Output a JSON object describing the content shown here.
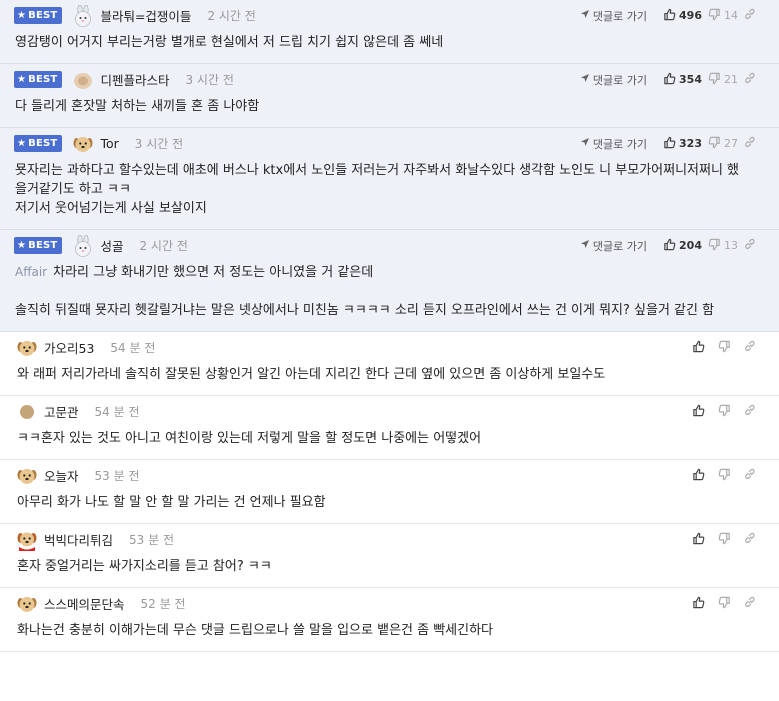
{
  "ui": {
    "best_label": "BEST",
    "reply_label": "댓글로 가기"
  },
  "comments": [
    {
      "best": true,
      "nick": "블라퉈=겁쟁이들",
      "avatar": "bunny-icon",
      "time": "2 시간 전",
      "up": "496",
      "down": "14",
      "prefix": "",
      "lines": [
        "영감탱이 어거지 부리는거랑 별개로 현실에서 저 드립 치기 쉽지 않은데 좀 쎄네"
      ]
    },
    {
      "best": true,
      "nick": "디펜플라스타",
      "avatar": "blurred-avatar",
      "time": "3 시간 전",
      "up": "354",
      "down": "21",
      "prefix": "",
      "lines": [
        "다 들리게 혼잣말 처하는 새끼들 혼 좀 나야함"
      ]
    },
    {
      "best": true,
      "nick": "Tor",
      "avatar": "puppy-icon",
      "time": "3 시간 전",
      "up": "323",
      "down": "27",
      "prefix": "",
      "lines": [
        "묫자리는 과하다고 할수있는데 애초에 버스나 ktx에서 노인들 저러는거 자주봐서 화날수있다 생각함 노인도 니 부모가어쩌니저쩌니 했",
        "을거같기도 하고 ㅋㅋ",
        "저기서 웃어넘기는게 사실 보살이지"
      ]
    },
    {
      "best": true,
      "nick": "성골",
      "avatar": "bunny-icon",
      "time": "2 시간 전",
      "up": "204",
      "down": "13",
      "prefix": "Affair",
      "lines": [
        "차라리 그냥 화내기만 했으면 저 정도는 아니였을 거 같은데",
        "",
        "솔직히 뒤질때 묫자리 헷갈릴거냐는 말은 넷상에서나 미친놈 ㅋㅋㅋㅋ 소리 듣지 오프라인에서 쓰는 건 이게 뭐지? 싶을거 같긴 함"
      ]
    },
    {
      "best": false,
      "nick": "가오리53",
      "avatar": "puppy-icon",
      "time": "54 분 전",
      "prefix": "",
      "lines": [
        "와 래퍼 저리가라네 솔직히 잘못된 상황인거 알긴 아는데 지리긴 한다 근데 옆에 있으면 좀 이상하게 보일수도"
      ]
    },
    {
      "best": false,
      "nick": "고문관",
      "avatar": "dot-avatar",
      "time": "54 분 전",
      "prefix": "",
      "lines": [
        "ㅋㅋ혼자 있는 것도 아니고 여친이랑 있는데 저렇게 말을 할 정도면 나중에는 어떻겠어"
      ]
    },
    {
      "best": false,
      "nick": "오늘자",
      "avatar": "puppy-icon",
      "time": "53 분 전",
      "prefix": "",
      "lines": [
        "아무리 화가 나도 할 말 안 할 말 가리는 건 언제나 필요함"
      ]
    },
    {
      "best": false,
      "nick": "벅빅다리튀김",
      "avatar": "red-puppy-icon",
      "time": "53 분 전",
      "prefix": "",
      "lines": [
        "혼자 중얼거리는 싸가지소리를 듣고 참어? ㅋㅋ"
      ]
    },
    {
      "best": false,
      "nick": "스스메의문단속",
      "avatar": "puppy-icon",
      "time": "52 분 전",
      "prefix": "",
      "lines": [
        "화나는건 충분히 이해가는데 무슨 댓글 드립으로나 쓸 말을 입으로 뱉은건 좀 빡세긴하다"
      ]
    }
  ]
}
